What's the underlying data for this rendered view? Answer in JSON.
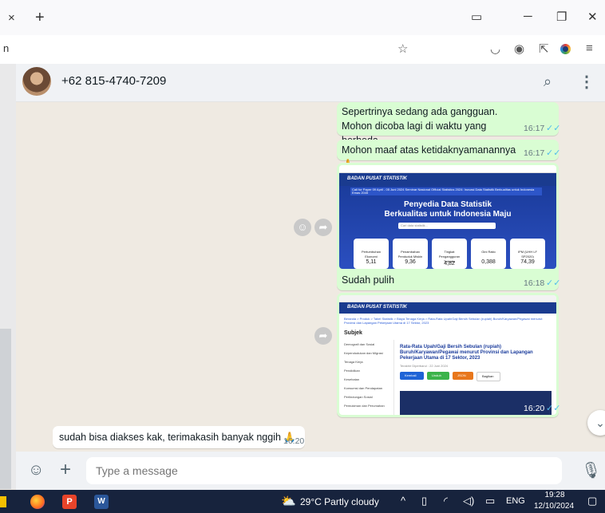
{
  "browser": {
    "tab_close": "×",
    "new_tab": "+",
    "url_fragment": "n",
    "icons": [
      "bookmark-star-icon",
      "pocket-icon",
      "account-icon",
      "extensions-icon",
      "profile-color-icon",
      "menu-icon"
    ]
  },
  "chat": {
    "contact": "+62 815-4740-7209",
    "messages": [
      {
        "dir": "out",
        "text": "Sepertrinya sedang ada gangguan. Mohon dicoba lagi di waktu yang berbeda.",
        "time": "16:17"
      },
      {
        "dir": "out",
        "text": "Mohon maaf atas ketidaknyamanannya 🙏",
        "time": "16:17"
      },
      {
        "dir": "out",
        "text": "Sudah pulih",
        "time": "16:18"
      },
      {
        "dir": "out",
        "time": "16:20"
      },
      {
        "dir": "in",
        "text": "sudah bisa diakses kak, terimakasih banyak nggih 🙏",
        "time": "16:20"
      }
    ],
    "shot1": {
      "site": "BADAN PUSAT STATISTIK",
      "banner": "Call for Paper 09 April - 05 Juni 2024 Seminar Nasional Official Statistics 2024: Inovasi Data Statistik Berkualitas untuk Indonesia Emas 2045",
      "hero1": "Penyedia Data Statistik",
      "hero2": "Berkualitas untuk Indonesia Maju",
      "search": "Cari data statistik...",
      "cards": [
        {
          "label": "Pertumbuhan Ekonomi",
          "value": "5,11"
        },
        {
          "label": "Penambahan Penduduk Miskin",
          "value": "9,36"
        },
        {
          "label": "Tingkat Pengangguran Terbuka",
          "value": "4,82"
        },
        {
          "label": "Gini Ratio",
          "value": "0,388"
        },
        {
          "label": "IPM (UHH LF SP2020)",
          "value": "74,39"
        }
      ]
    },
    "shot2": {
      "site": "BADAN PUSAT STATISTIK",
      "breadcrumb": "Beranda > Produk > Tabel Statistik > Biaya Tenaga Kerja > Rata-Rata Upah/Gaji Bersih Sebulan (rupiah) Buruh/Karyawan/Pegawai menurut Provinsi dan Lapangan Pekerjaan Utama di 17 Sektor, 2023",
      "subjek": "Subjek",
      "title": "Rata-Rata Upah/Gaji Bersih Sebulan (rupiah) Buruh/Karyawan/Pegawai menurut Provinsi dan Lapangan Pekerjaan Utama di 17 Sektor, 2023",
      "updated": "Terakhir Diperbarui : 22 Juni 2024",
      "buttons": [
        "Kembali",
        "Unduh",
        "JSON",
        "Bagikan"
      ],
      "sidebar": [
        "Demografi dan Sosial",
        "Kependudukan dan Migrasi",
        "Tenaga Kerja",
        "Pendidikan",
        "Kesehatan",
        "Konsumsi dan Pendapatan",
        "Perlindungan Sosial",
        "Pemukiman dan Perumahan"
      ]
    }
  },
  "composer": {
    "placeholder": "Type a message"
  },
  "taskbar": {
    "weather": "29°C  Partly cloudy",
    "lang": "ENG",
    "time": "19:28",
    "date": "12/10/2024"
  },
  "colors": {
    "outgoing": "#d9fdd3",
    "incoming": "#ffffff",
    "bg": "#efeae2",
    "tick": "#53bdeb",
    "bps_blue": "#1b3c9c"
  }
}
